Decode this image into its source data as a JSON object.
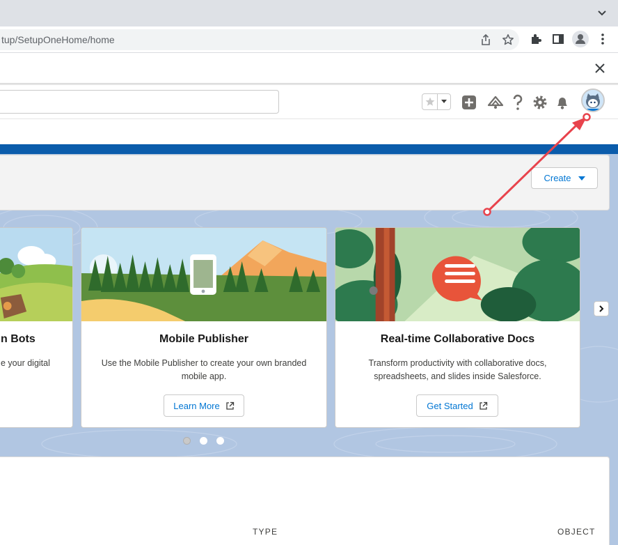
{
  "browser": {
    "url": "tup/SetupOneHome/home",
    "icons": [
      "chevron-down-icon",
      "share-icon",
      "star-icon",
      "extensions-icon",
      "sidepanel-icon",
      "profile-icon",
      "more-icon"
    ]
  },
  "banner": {
    "close_icon": "close-icon"
  },
  "header": {
    "icons": [
      "favorites-star-icon",
      "favorites-dropdown-icon",
      "global-create-icon",
      "trailhead-icon",
      "help-icon",
      "setup-gear-icon",
      "notifications-bell-icon",
      "user-avatar"
    ]
  },
  "page": {
    "create_label": "Create"
  },
  "carousel": {
    "cards": [
      {
        "title": "n Bots",
        "desc": "e your digital",
        "button": ""
      },
      {
        "title": "Mobile Publisher",
        "desc": "Use the Mobile Publisher to create your own branded mobile app.",
        "button": "Learn More"
      },
      {
        "title": "Real-time Collaborative Docs",
        "desc": "Transform productivity with collaborative docs, spreadsheets, and slides inside Salesforce.",
        "button": "Get Started"
      }
    ],
    "dots": 3,
    "active_dot": 1
  },
  "table": {
    "columns": [
      "TYPE",
      "OBJECT"
    ]
  },
  "colors": {
    "brand_band": "#0b5cab",
    "page_bg": "#b1c6e2",
    "link_blue": "#0176d3",
    "annotation_red": "#e8434c"
  }
}
